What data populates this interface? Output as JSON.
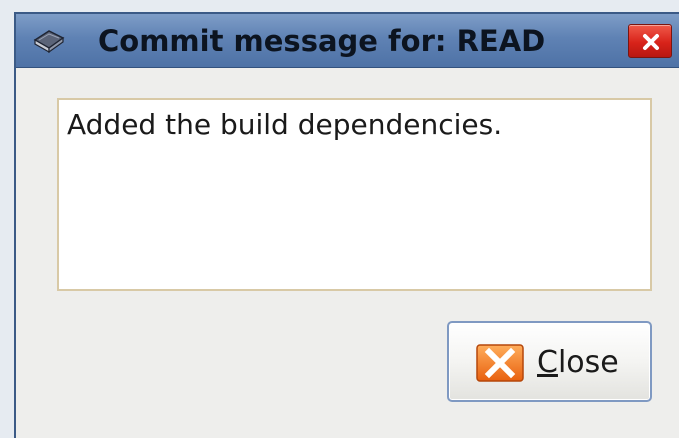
{
  "window": {
    "title": "Commit message for: READ",
    "title_icon": "notebook-icon",
    "close_icon": "close-x-icon"
  },
  "message": {
    "text": "Added the build dependencies."
  },
  "buttons": {
    "close_mnemonic": "C",
    "close_rest": "lose",
    "close_icon": "cancel-x-icon"
  },
  "colors": {
    "titlebar": "#5f82b4",
    "close_red": "#d8231a",
    "button_icon_orange": "#f07a22",
    "textbox_border": "#d8c9a6"
  }
}
